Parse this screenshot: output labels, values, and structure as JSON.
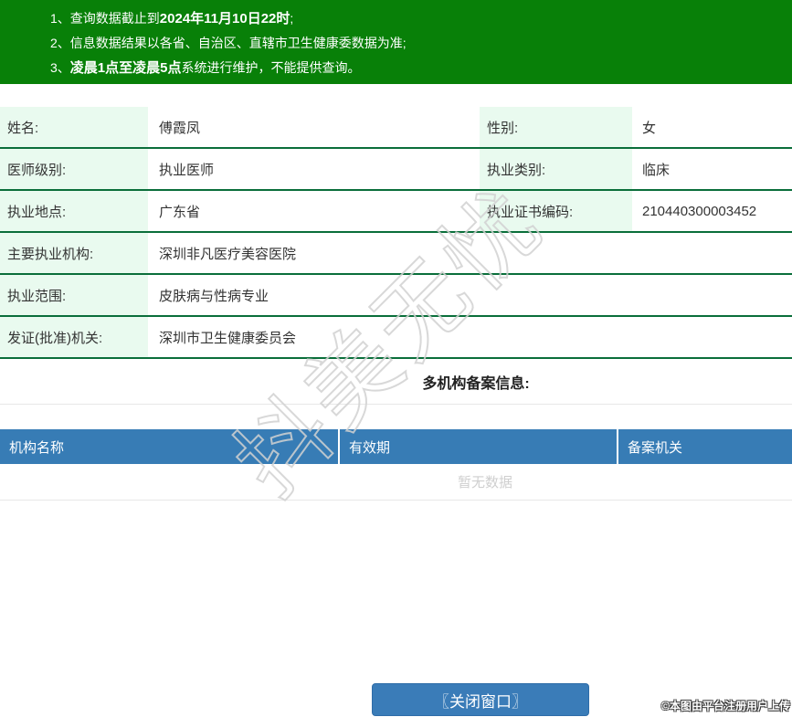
{
  "notices": {
    "items": [
      {
        "num": "1、",
        "pre": "查询数据截止到",
        "bold": "2024年11月10日22时",
        "post": ";"
      },
      {
        "num": "2、",
        "pre": "信息数据结果以各省、自治区、直辖市卫生健康委数据为准;",
        "bold": "",
        "post": ""
      },
      {
        "num": "3、",
        "pre": "",
        "bold": "凌晨1点至凌晨5点",
        "post": "系统进行维护，不能提供查询。"
      }
    ]
  },
  "profile": {
    "rows": [
      {
        "label": "姓名:",
        "value": "傅霞凤",
        "label2": "性别:",
        "value2": "女"
      },
      {
        "label": "医师级别:",
        "value": "执业医师",
        "label2": "执业类别:",
        "value2": "临床"
      },
      {
        "label": "执业地点:",
        "value": "广东省",
        "label2": "执业证书编码:",
        "value2": "210440300003452"
      },
      {
        "label": "主要执业机构:",
        "value": "深圳非凡医疗美容医院"
      },
      {
        "label": "执业范围:",
        "value": "皮肤病与性病专业"
      },
      {
        "label": "发证(批准)机关:",
        "value": "深圳市卫生健康委员会"
      }
    ]
  },
  "multi_org": {
    "section_title": "多机构备案信息:",
    "columns": [
      "机构名称",
      "有效期",
      "备案机关"
    ],
    "empty_text": "暂无数据"
  },
  "footer": {
    "close_button_label": "〖关闭窗口〗",
    "copyright": "©本图由平台注册用户上传"
  },
  "watermark": "抖美无忧",
  "colors": {
    "header_green": "#088008",
    "label_cell_green": "#e9faef",
    "row_border_green": "#0a6e3a",
    "table_header_blue": "#377cb5",
    "button_blue": "#3a7cb8"
  }
}
